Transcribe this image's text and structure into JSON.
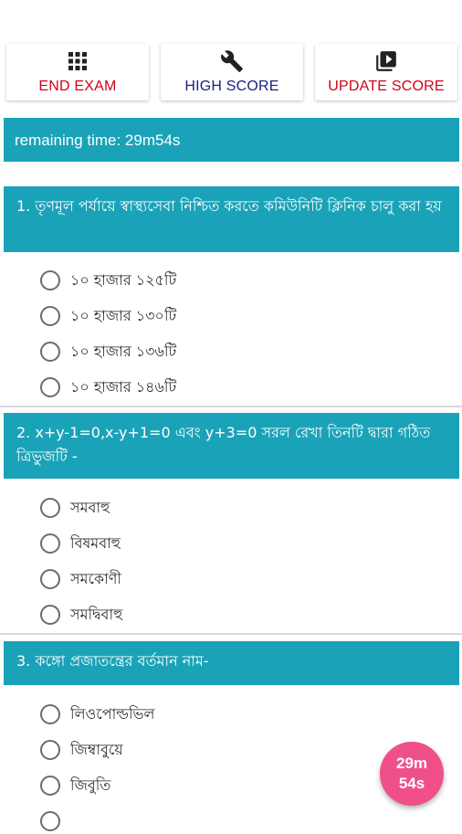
{
  "toolbar": {
    "end_exam": {
      "label": "END EXAM",
      "color": "#d0021b",
      "icon": "grid-icon"
    },
    "high_score": {
      "label": "HIGH SCORE",
      "color": "#1a237e",
      "icon": "wrench-icon"
    },
    "update_score": {
      "label": "UPDATE SCORE",
      "color": "#d0021b",
      "icon": "video-library-icon"
    }
  },
  "timer": {
    "text": "remaining time: 29m54s"
  },
  "questions": [
    {
      "title": "1. তৃণমূল পর্যায়ে স্বাস্থ্যসেবা নিশ্চিত করতে কমিউনিটি ক্লিনিক চালু করা হয়",
      "options": [
        "১০ হাজার ১২৫টি",
        "১০ হাজার ১৩০টি",
        "১০ হাজার ১৩৬টি",
        "১০ হাজার ১৪৬টি"
      ]
    },
    {
      "title": "2. x+y-1=0,x-y+1=0 এবং y+3=0 সরল রেখা তিনটি দ্বারা গঠিত ত্রিভুজটি -",
      "options": [
        "সমবাহু",
        "বিষমবাহু",
        "সমকোণী",
        "সমদ্বিবাহু"
      ]
    },
    {
      "title": "3. কঙ্গো প্রজাতন্ত্রের বর্তমান নাম-",
      "options": [
        "লিওপোল্ডভিল",
        "জিম্বাবুয়ে",
        "জিবুতি"
      ]
    }
  ],
  "fab": {
    "line1": "29m",
    "line2": "54s",
    "color": "#f0508a"
  },
  "colors": {
    "accent": "#1aa3b8"
  }
}
